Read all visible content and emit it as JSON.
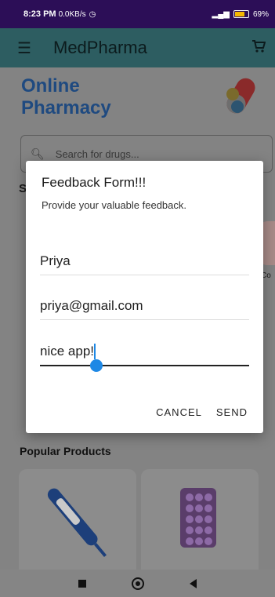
{
  "status_bar": {
    "time": "8:23 PM",
    "net_speed": "0.0KB/s",
    "battery": "69%"
  },
  "app_bar": {
    "menu_icon": "hamburger-menu-icon",
    "title": "MedPharma",
    "cart_icon": "cart-icon"
  },
  "hero": {
    "title_line1": "Online",
    "title_line2": "Pharmacy"
  },
  "search": {
    "placeholder": "Search for drugs..."
  },
  "section": {
    "label": "S"
  },
  "side_card": {
    "label": "Co"
  },
  "popular": {
    "title": "Popular Products"
  },
  "dialog": {
    "title": "Feedback Form!!!",
    "subtitle": "Provide your valuable feedback.",
    "name_value": "Priya",
    "email_value": "priya@gmail.com",
    "feedback_value": "nice app!",
    "cancel_label": "CANCEL",
    "send_label": "SEND"
  },
  "colors": {
    "status_bar": "#2c0e57",
    "app_bar": "#2d5d61",
    "accent": "#1e88e5",
    "hero_title": "#1f4a80"
  }
}
